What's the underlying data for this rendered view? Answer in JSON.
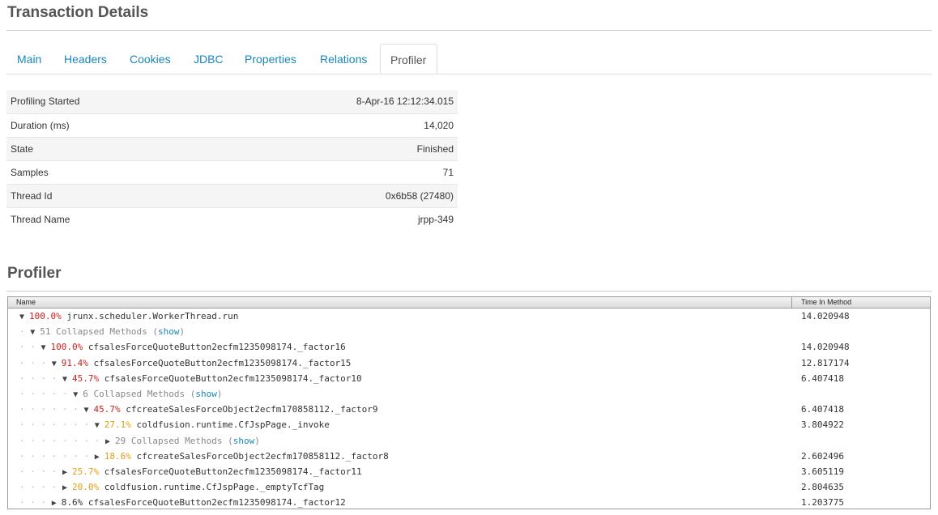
{
  "page_title": "Transaction Details",
  "tabs": [
    {
      "label": "Main"
    },
    {
      "label": "Headers"
    },
    {
      "label": "Cookies"
    },
    {
      "label": "JDBC"
    },
    {
      "label": "Properties"
    },
    {
      "label": "Relations"
    },
    {
      "label": "Profiler"
    }
  ],
  "active_tab": "Profiler",
  "summary": [
    {
      "key": "Profiling Started",
      "value": "8-Apr-16 12:12:34.015"
    },
    {
      "key": "Duration (ms)",
      "value": "14,020"
    },
    {
      "key": "State",
      "value": "Finished"
    },
    {
      "key": "Samples",
      "value": "71"
    },
    {
      "key": "Thread Id",
      "value": "0x6b58 (27480)"
    },
    {
      "key": "Thread Name",
      "value": "jrpp-349"
    }
  ],
  "profiler_title": "Profiler",
  "grid_headers": {
    "name": "Name",
    "time": "Time In Method"
  },
  "rows": [
    {
      "indent": 0,
      "expander": "▼",
      "pct": "100.0%",
      "pct_color": "red",
      "method": "jrunx.scheduler.WorkerThread.run",
      "time": "14.020948"
    },
    {
      "indent": 1,
      "expander": "▼",
      "collapsed": "51 Collapsed Methods",
      "show": "show"
    },
    {
      "indent": 2,
      "expander": "▼",
      "pct": "100.0%",
      "pct_color": "red",
      "method": "cfsalesForceQuoteButton2ecfm1235098174._factor16",
      "time": "14.020948"
    },
    {
      "indent": 3,
      "expander": "▼",
      "pct": "91.4%",
      "pct_color": "red",
      "method": "cfsalesForceQuoteButton2ecfm1235098174._factor15",
      "time": "12.817174"
    },
    {
      "indent": 4,
      "expander": "▼",
      "pct": "45.7%",
      "pct_color": "red",
      "method": "cfsalesForceQuoteButton2ecfm1235098174._factor10",
      "time": "6.407418"
    },
    {
      "indent": 5,
      "expander": "▼",
      "collapsed": "6 Collapsed Methods",
      "show": "show"
    },
    {
      "indent": 6,
      "expander": "▼",
      "pct": "45.7%",
      "pct_color": "red",
      "method": "cfcreateSalesForceObject2ecfm170858112._factor9",
      "time": "6.407418"
    },
    {
      "indent": 7,
      "expander": "▼",
      "pct": "27.1%",
      "pct_color": "orange",
      "method": "coldfusion.runtime.CfJspPage._invoke",
      "time": "3.804922"
    },
    {
      "indent": 8,
      "expander": "▶",
      "collapsed": "29 Collapsed Methods",
      "show": "show"
    },
    {
      "indent": 7,
      "expander": "▶",
      "pct": "18.6%",
      "pct_color": "orange",
      "method": "cfcreateSalesForceObject2ecfm170858112._factor8",
      "time": "2.602496"
    },
    {
      "indent": 4,
      "expander": "▶",
      "pct": "25.7%",
      "pct_color": "orange",
      "method": "cfsalesForceQuoteButton2ecfm1235098174._factor11",
      "time": "3.605119"
    },
    {
      "indent": 4,
      "expander": "▶",
      "pct": "20.0%",
      "pct_color": "orange",
      "method": "coldfusion.runtime.CfJspPage._emptyTcfTag",
      "time": "2.804635"
    },
    {
      "indent": 3,
      "expander": "▶",
      "pct": "8.6%",
      "pct_color": "black",
      "method": "cfsalesForceQuoteButton2ecfm1235098174._factor12",
      "time": "1.203775"
    }
  ]
}
